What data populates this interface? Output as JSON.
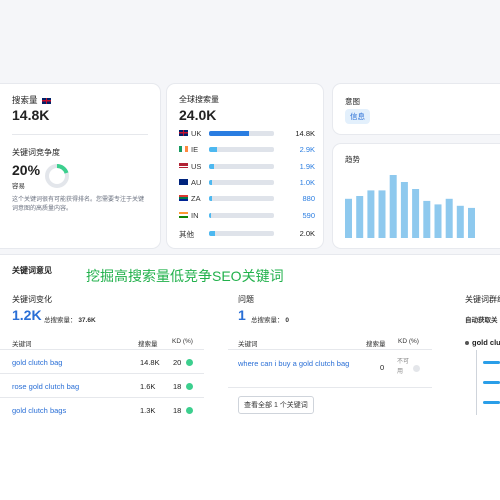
{
  "overlay_title": "挖掘高搜索量低竞争SEO关键词",
  "volume": {
    "label": "搜索量",
    "value": "14.8K"
  },
  "difficulty": {
    "label": "关键词竞争度",
    "value": "20%",
    "level": "容易",
    "percent": 20,
    "description": "这个关键词很有可能获得排名。您需要专注于关键词意图的高质量内容。"
  },
  "global": {
    "label": "全球搜索量",
    "value": "24.0K",
    "rows": [
      {
        "code": "UK",
        "value": "14.8K",
        "fill": 0.62,
        "flag": "uk"
      },
      {
        "code": "IE",
        "value": "2.9K",
        "fill": 0.12,
        "flag": "ie"
      },
      {
        "code": "US",
        "value": "1.9K",
        "fill": 0.08,
        "flag": "us"
      },
      {
        "code": "AU",
        "value": "1.0K",
        "fill": 0.05,
        "flag": "au"
      },
      {
        "code": "ZA",
        "value": "880",
        "fill": 0.04,
        "flag": "za"
      },
      {
        "code": "IN",
        "value": "590",
        "fill": 0.03,
        "flag": "in"
      }
    ],
    "other_label": "其他",
    "other_value": "2.0K",
    "other_fill": 0.09
  },
  "intent": {
    "label": "意图",
    "badge": "信息"
  },
  "trend": {
    "label": "趋势",
    "values": [
      0.56,
      0.6,
      0.68,
      0.68,
      0.9,
      0.8,
      0.7,
      0.53,
      0.48,
      0.56,
      0.46,
      0.43
    ]
  },
  "ideas": {
    "title": "关键词意见",
    "variations": {
      "label": "关键词变化",
      "count": "1.2K",
      "total_label": "总搜索量：",
      "total_value": "37.6K",
      "headers": {
        "kw": "关键词",
        "vol": "搜索量",
        "kd": "KD (%)"
      },
      "rows": [
        {
          "kw": "gold clutch bag",
          "vol": "14.8K",
          "kd": "20"
        },
        {
          "kw": "rose gold clutch bag",
          "vol": "1.6K",
          "kd": "18"
        },
        {
          "kw": "gold clutch bags",
          "vol": "1.3K",
          "kd": "18"
        }
      ]
    },
    "questions": {
      "label": "问题",
      "count": "1",
      "total_label": "总搜索量：",
      "total_value": "0",
      "headers": {
        "kw": "关键词",
        "vol": "搜索量",
        "kd": "KD (%)"
      },
      "rows": [
        {
          "kw": "where can i buy a gold clutch bag",
          "vol": "0",
          "kd": "不可用"
        }
      ],
      "view_all": "查看全部 1 个关键词"
    },
    "clusters": {
      "label": "关键词群组",
      "sub": "自动获取关",
      "node": "gold clu"
    }
  }
}
